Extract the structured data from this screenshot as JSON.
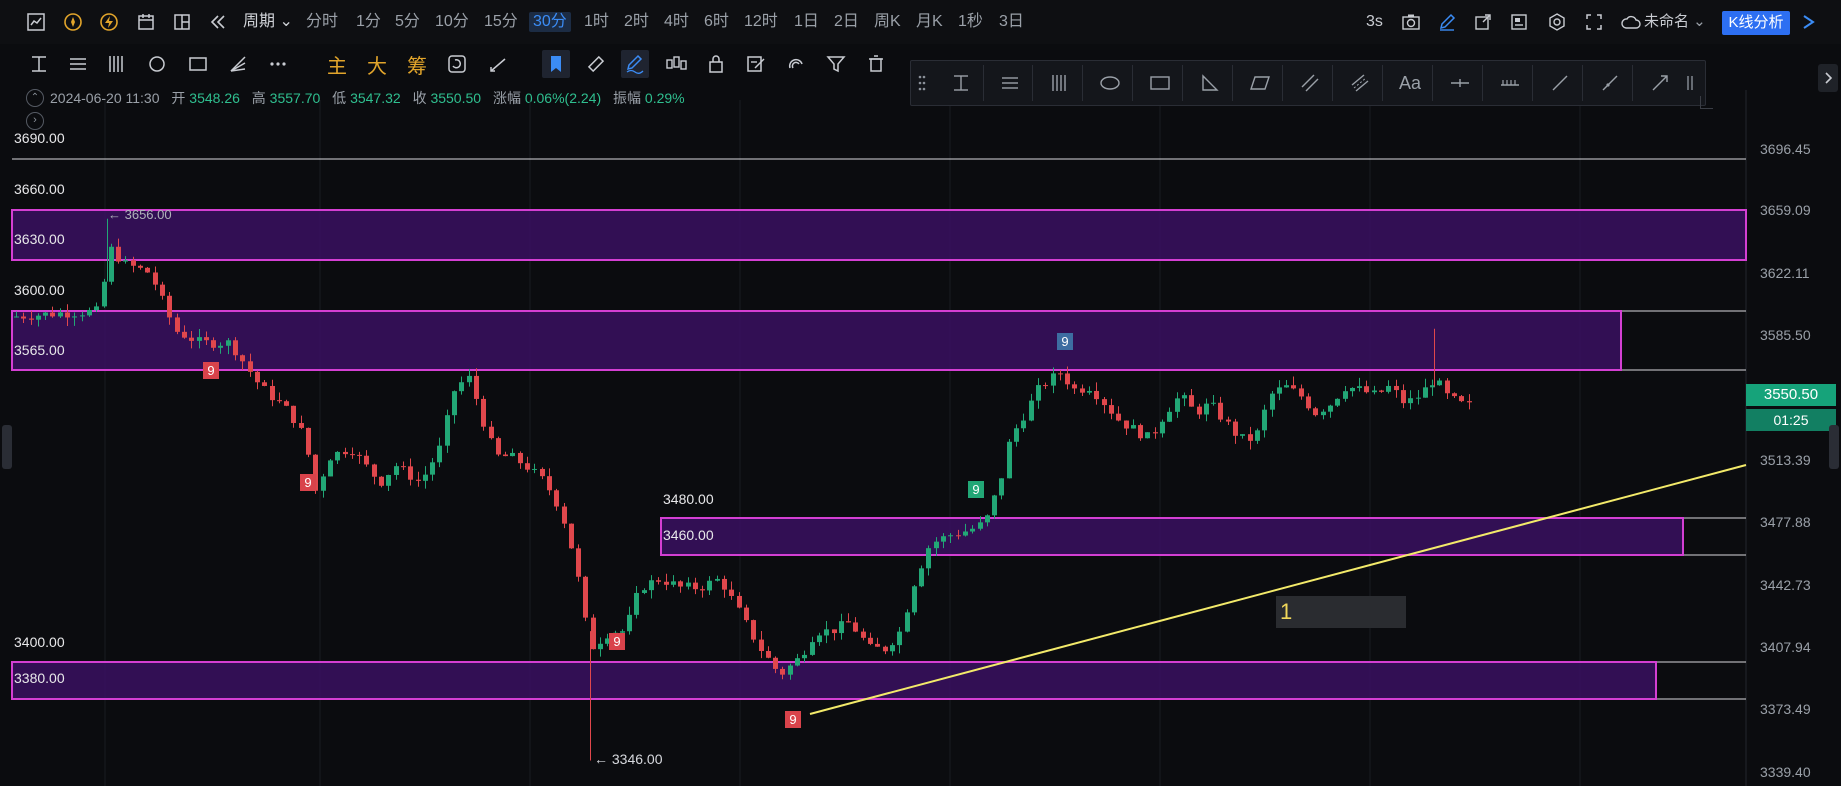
{
  "toolbar": {
    "period_label": "周期",
    "periods": [
      "分时",
      "1分",
      "5分",
      "10分",
      "15分",
      "30分",
      "1时",
      "2时",
      "4时",
      "6时",
      "12时",
      "1日",
      "2日",
      "周K",
      "月K",
      "1秒",
      "3日"
    ],
    "active_period": "30分",
    "refresh": "3s",
    "workspace_name": "未命名",
    "kline_button": "K线分析",
    "icons": [
      "chart-icon",
      "compass-icon",
      "lightning-icon",
      "calendar-icon",
      "layout-icon",
      "rewind-icon"
    ]
  },
  "toolbar2": {
    "gold_labels": [
      "主",
      "大",
      "筹"
    ]
  },
  "ohlc": {
    "datetime": "2024-06-20 11:30",
    "open_label": "开",
    "open": "3548.26",
    "high_label": "高",
    "high": "3557.70",
    "low_label": "低",
    "low": "3547.32",
    "close_label": "收",
    "close": "3550.50",
    "change_label": "涨幅",
    "change": "0.06%(2.24)",
    "amplitude_label": "振幅",
    "amplitude": "0.29%"
  },
  "float_toolbar": {
    "text_tool": "Aa"
  },
  "y_axis": {
    "labels": [
      "3696.45",
      "3659.09",
      "3622.11",
      "3585.50",
      "3550.50",
      "3513.39",
      "3477.88",
      "3442.73",
      "3407.94",
      "3373.49",
      "3339.40"
    ]
  },
  "price_tag": {
    "price": "3550.50",
    "countdown": "01:25"
  },
  "levels": {
    "lines": [
      "3690.00",
      "3660.00",
      "3600.00",
      "3480.00",
      "3400.00"
    ],
    "zones": [
      "3630.00",
      "3565.00",
      "3460.00",
      "3380.00"
    ]
  },
  "markers": {
    "high_note": "← 3656.00",
    "low_note": "← 3346.00",
    "nine": "9"
  },
  "note": {
    "text": "1"
  },
  "colors": {
    "up": "#22a776",
    "down": "#e0474c",
    "zone_border": "#d43fd3",
    "zone_fill": "#3a1160",
    "trend": "#f3ea6a",
    "accent": "#2d6ff2"
  }
}
